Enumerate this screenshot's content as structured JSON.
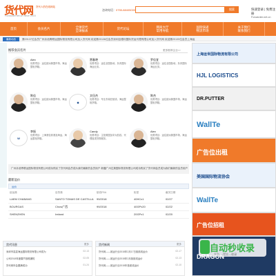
{
  "header": {
    "logo": "货代网",
    "logo_sub": "Forwarder.net.cn  Since 2015",
    "slogan": "货代人的在线网站",
    "slogan2": "",
    "hotline_label": "咨询电话：",
    "hotline_value": "0755-88405000(深圳市)",
    "search_button": "搜索",
    "login_link": "快速登录 | 免费注册",
    "top_links": "Forwarder.net.cn"
  },
  "nav": {
    "items": [
      {
        "label": "首页"
      },
      {
        "label": "会员名片"
      },
      {
        "label": "全球货代|全球报表",
        "double": true
      },
      {
        "label": "货代论坛"
      },
      {
        "label": "网商大厅|常用导航",
        "double": true
      },
      {
        "label": "国际快递|物流市场",
        "double": true
      },
      {
        "label": "关于我们|联系我们",
        "double": true
      }
    ]
  },
  "marquee": {
    "label": "最新动态",
    "text": "第20137位会员广州泳池青联运国际物流有限公司加入货代网   欢迎第20136位会员深圳百德利国际货运代理有限公司加入货代网   欢迎第20135位会员上海运"
  },
  "recommend": {
    "title": "推荐会员名片",
    "more": "更多推荐企业>>",
    "cards": [
      {
        "name": "Alex",
        "desc": "优势项目：运往欧洲美国市场，海运整柜拼箱。"
      },
      {
        "name": "贾春艳",
        "desc": "优势项目：运往全国各地，负责国际海运业务。"
      },
      {
        "name": "罗佳宜",
        "desc": "优势项目：运往全国各地，负责国际海运业务。"
      },
      {
        "name": "陈佳",
        "desc": "优势项目：运往欧洲美国市场，海运整柜拼箱。"
      },
      {
        "name": "文伍杰",
        "desc": "优势项目：专业东南亚航线，海运整柜拼箱。"
      },
      {
        "name": "陈杰",
        "desc": "优势项目：运往欧洲美国市场，海运整柜拼箱。"
      },
      {
        "name": "李振",
        "desc": "优势项目：上海港包到港及海运，海运整柜拼箱。"
      },
      {
        "name": "Candy",
        "desc": "优势项目：主营美国加拿大航线，代理各类货物服务。"
      },
      {
        "name": "Alex",
        "desc": "优势项目：运往欧洲美国市场，海运整柜拼箱。"
      }
    ]
  },
  "band_text": "广州泳池青联运国际物流有限公司成功购买了货代网会员成为我们最新的会员用户    新疆广州达美国际物流有限公司成功购买了货代网会员成为我们最新的会员用户",
  "freight": {
    "title": "最新运价",
    "tab": "运价",
    "columns": [
      "起运港",
      "目的港",
      "航线FBA",
      "柜型",
      "截关日期"
    ],
    "rows": [
      [
        "LAEM CHABANG",
        "SANTO TOMAS DE CASTILLA",
        "99/2018",
        "40HCx1",
        "02/27"
      ],
      [
        "BOURGAS",
        "Chow广西",
        "99/2018",
        "40GPx20",
        "02/22"
      ],
      [
        "SHENZHEN",
        "Ireland",
        "",
        "20GPx1",
        "02/20"
      ]
    ]
  },
  "news_left": {
    "title": "货代讯息",
    "more": "更多",
    "items": [
      {
        "text": "深圳市嘉嘉海运国际物流有限公司成为",
        "date": "02-13"
      },
      {
        "text": "公司2018年度春节放假通知",
        "date": "02-05"
      },
      {
        "text": "货代网年会圆满成功",
        "date": "01-24"
      }
    ]
  },
  "news_right": {
    "title": "货代新闻",
    "more": "更多",
    "items": [
      {
        "text": "货代网——致运行业2015年2月17日各航线运价",
        "date": "02-17"
      },
      {
        "text": "货代网——致运行业2015年2月各航线运价",
        "date": "02-13"
      },
      {
        "text": "货代网——致运行业2015年各航线运价",
        "date": "02-10"
      }
    ]
  },
  "ads": [
    {
      "text": "上海运世国际物流有限公司",
      "color": "#1a4b8c"
    },
    {
      "text": "HJL LOGISTICS",
      "color": "#1a4b8c"
    },
    {
      "text": "DR.PUTTER",
      "color": "#111"
    },
    {
      "text": "WallTe",
      "color": "#2a7fc0"
    },
    {
      "text": "广告位出租",
      "color": "#fff"
    },
    {
      "text": "美国国际物流协会",
      "color": "#1a4b8c"
    },
    {
      "text": "WallTe",
      "color": "#2a7fc0"
    },
    {
      "text": "广告位招租",
      "color": "#fff"
    },
    {
      "text": "DRAGON",
      "color": "#fff"
    }
  ],
  "watermark": {
    "text": "自动秒收录",
    "sub": "—平台  —提交—收录"
  },
  "colors": {
    "brand": "#f07a2a",
    "accent_blue": "#2d6fbf"
  }
}
